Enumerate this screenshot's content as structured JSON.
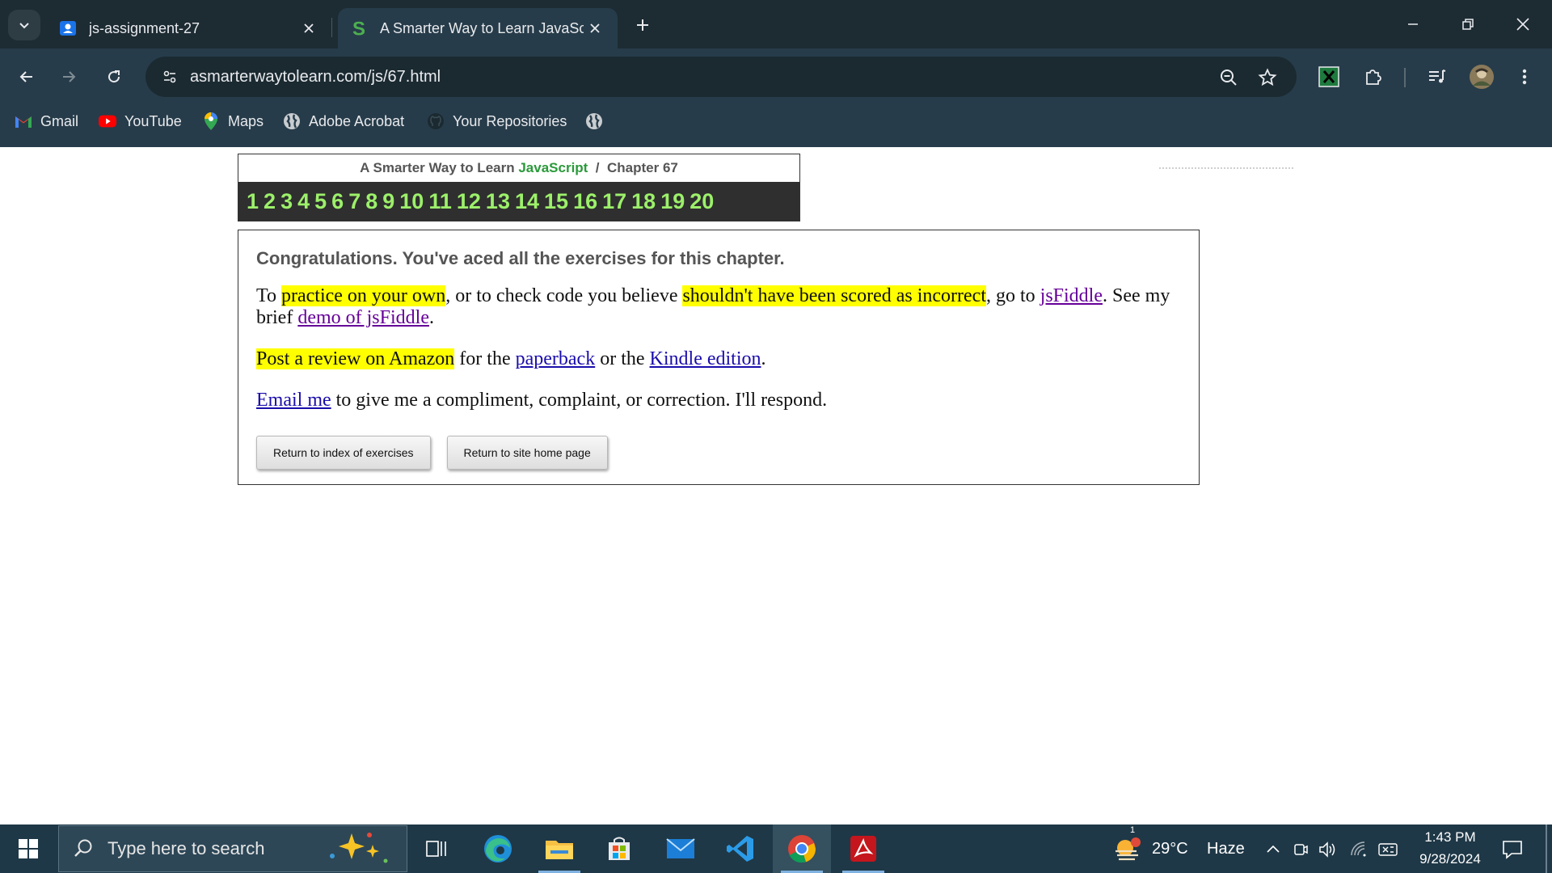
{
  "browser": {
    "tabs": [
      {
        "title": "js-assignment-27",
        "favicon": "contacts-icon",
        "active": false
      },
      {
        "title": "A Smarter Way to Learn JavaScr",
        "favicon": "smarter-way-s-logo",
        "active": true
      }
    ],
    "url": "asmarterwaytolearn.com/js/67.html",
    "bookmarks": [
      {
        "label": "Gmail",
        "icon": "gmail-icon"
      },
      {
        "label": "YouTube",
        "icon": "youtube-icon"
      },
      {
        "label": "Maps",
        "icon": "maps-icon"
      },
      {
        "label": "Adobe Acrobat",
        "icon": "globe-icon"
      },
      {
        "label": "Your Repositories",
        "icon": "github-icon"
      }
    ]
  },
  "page": {
    "breadcrumb": {
      "prefix": "A Smarter Way to Learn",
      "subject": "JavaScript",
      "separator": "/",
      "chapter": "Chapter 67"
    },
    "exercise_numbers": [
      "1",
      "2",
      "3",
      "4",
      "5",
      "6",
      "7",
      "8",
      "9",
      "10",
      "11",
      "12",
      "13",
      "14",
      "15",
      "16",
      "17",
      "18",
      "19",
      "20"
    ],
    "headline": "Congratulations. You've aced all the exercises for this chapter.",
    "p1": {
      "t1": "To ",
      "h1": "practice on your own",
      "t2": ", or to check code you believe ",
      "h2": "shouldn't have been scored as incorrect",
      "t3": ", go to ",
      "link1": "jsFiddle",
      "t4": ". See my brief ",
      "link2": "demo of jsFiddle",
      "t5": "."
    },
    "p2": {
      "h1": "Post a review on Amazon",
      "t1": " for the ",
      "link1": "paperback",
      "t2": " or the ",
      "link2": "Kindle edition",
      "t3": "."
    },
    "p3": {
      "link1": "Email me",
      "t1": " to give me a compliment, complaint, or correction. I'll respond."
    },
    "buttons": {
      "index": "Return to index of exercises",
      "home": "Return to site home page"
    }
  },
  "taskbar": {
    "search_placeholder": "Type here to search",
    "apps": [
      "task-view",
      "edge",
      "file-explorer",
      "microsoft-store",
      "mail",
      "vscode",
      "chrome",
      "adobe-acrobat"
    ],
    "active_app": "chrome",
    "weather": {
      "temp": "29°C",
      "condition": "Haze",
      "badge": "1"
    },
    "time": "1:43 PM",
    "date": "9/28/2024"
  },
  "colors": {
    "highlight": "#ffff00",
    "number_green": "#9cf06a",
    "js_green": "#2a9a3a",
    "link": "#1a0dab",
    "visited": "#660099"
  }
}
